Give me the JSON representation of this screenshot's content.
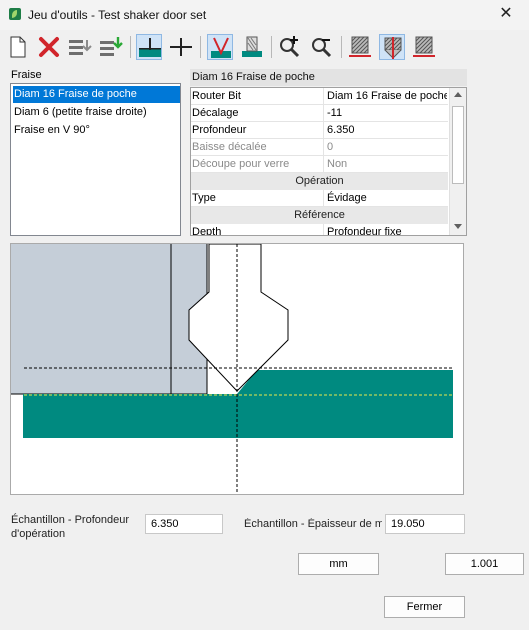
{
  "window": {
    "title": "Jeu d'outils - Test shaker door set",
    "close_glyph": "✕"
  },
  "toolbar": {
    "icons": [
      "new-document-icon",
      "delete-icon",
      "move-down-list-icon",
      "import-icon",
      "cut-position-low-icon",
      "cut-position-high-icon",
      "vbit-profile-icon",
      "straight-bit-profile-icon",
      "zoom-in-icon",
      "zoom-out-icon",
      "hatch-left-icon",
      "hatch-center-icon",
      "hatch-right-icon"
    ]
  },
  "tool_list": {
    "label": "Fraise",
    "items": [
      "Diam 16 Fraise de poche",
      "Diam 6 (petite fraise droite)",
      "Fraise en V 90°"
    ],
    "selected": "Diam 16 Fraise de poche"
  },
  "properties": {
    "header": "Diam 16 Fraise de poche",
    "router_bit": {
      "key": "Router Bit",
      "value": "Diam 16 Fraise de poche"
    },
    "decalage": {
      "key": "Décalage",
      "value": "-11"
    },
    "profondeur": {
      "key": "Profondeur",
      "value": "6.350"
    },
    "baisse": {
      "key": "Baisse décalée",
      "value": "0"
    },
    "verre": {
      "key": "Découpe pour verre",
      "value": "Non"
    },
    "cat_operation": "Opération",
    "type": {
      "key": "Type",
      "value": "Évidage"
    },
    "cat_reference": "Référence",
    "depth": {
      "key": "Depth",
      "value": "Profondeur fixe"
    }
  },
  "drawing": {
    "colors": {
      "board": "#c5ced8",
      "material": "#008a80",
      "bit": "#ffffff",
      "outline": "#000000",
      "depth_line": "#e8e84a"
    }
  },
  "sample": {
    "depth_label": "Échantillon - Profondeur d'opération",
    "depth_value": "6.350",
    "thickness_label": "Échantillon - Épaisseur de m",
    "thickness_value": "19.050",
    "units_button": "mm",
    "scale_button": "1.001",
    "close_button": "Fermer"
  }
}
